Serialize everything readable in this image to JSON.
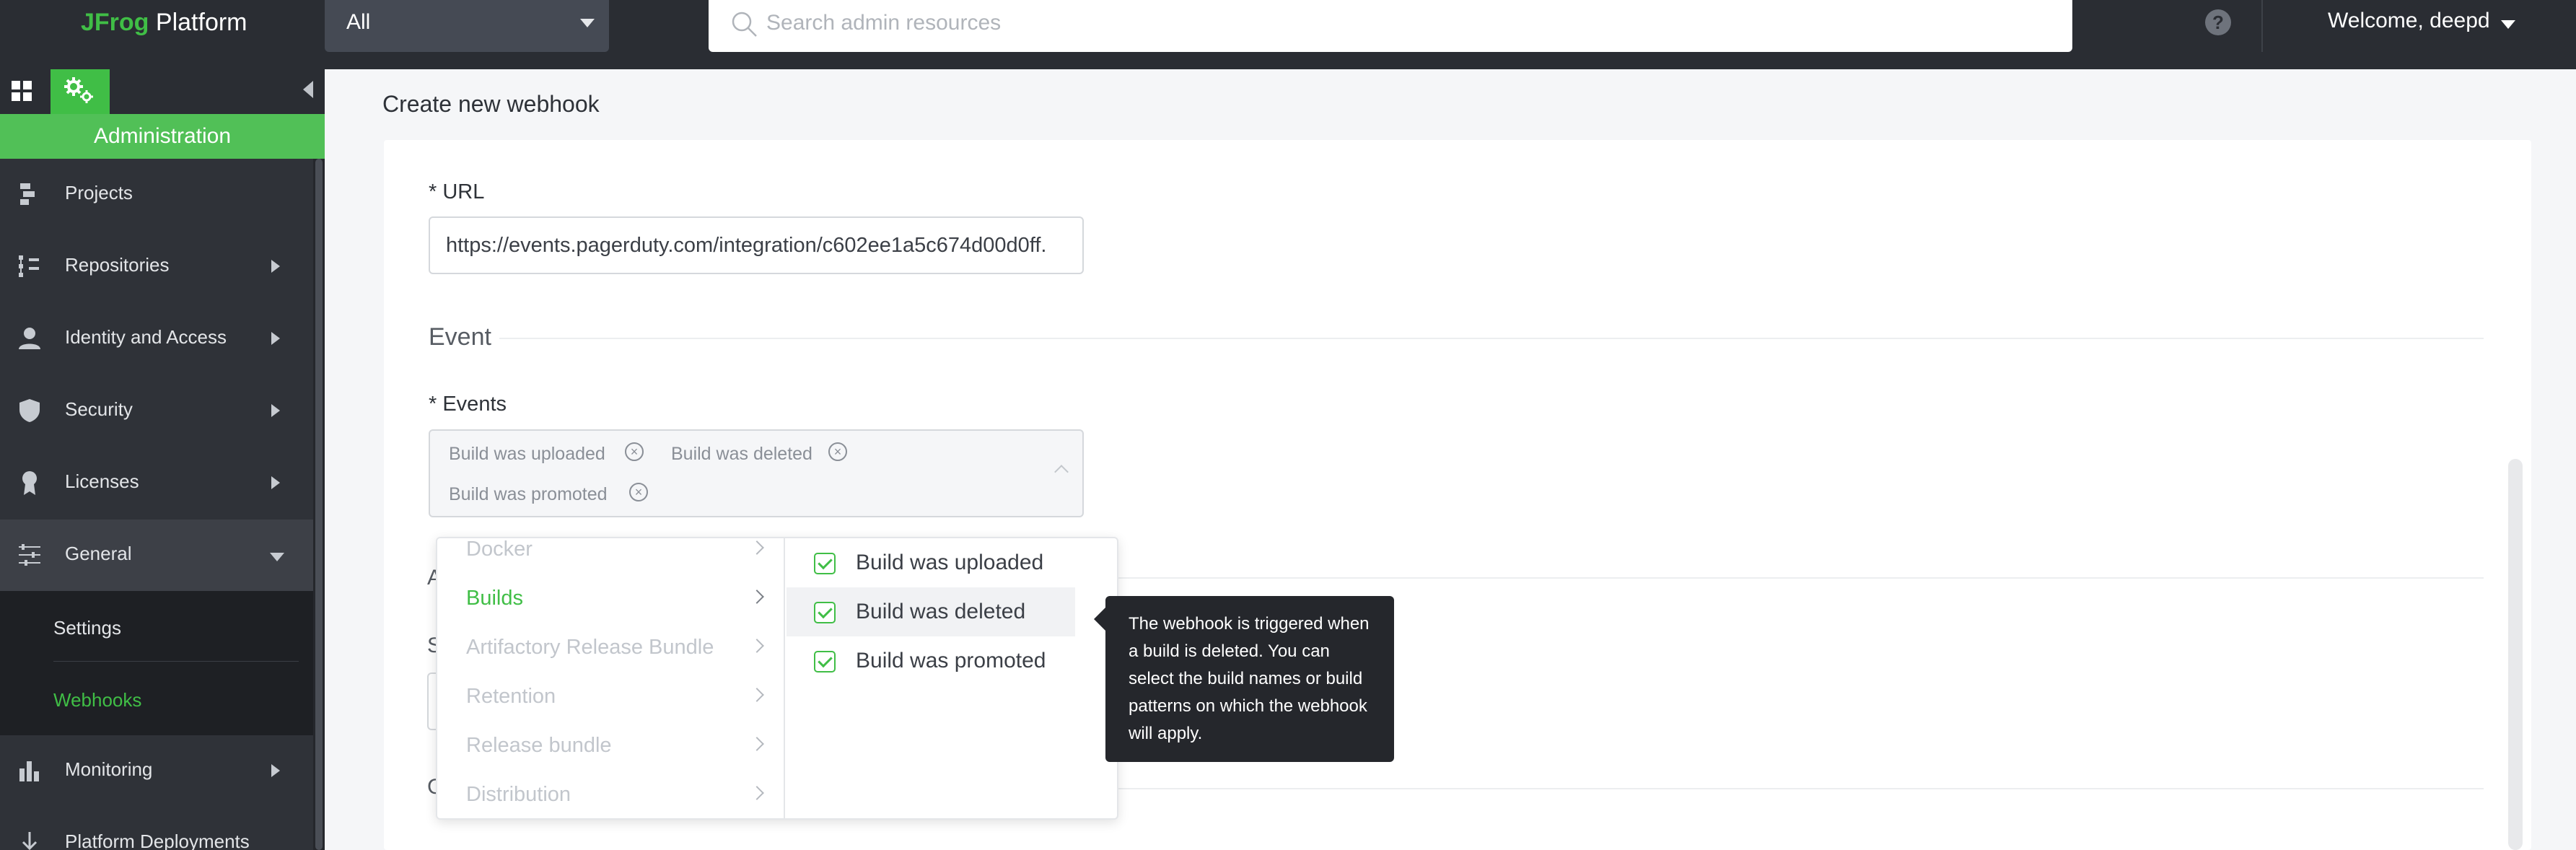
{
  "header": {
    "logo_brand": "JFrog",
    "logo_product": "Platform",
    "scope_value": "All",
    "search_placeholder": "Search admin resources",
    "help_glyph": "?",
    "welcome": "Welcome, deepd"
  },
  "sidebar": {
    "section": "Administration",
    "items": [
      {
        "label": "Projects",
        "icon": "projects-icon"
      },
      {
        "label": "Repositories",
        "icon": "repositories-icon"
      },
      {
        "label": "Identity and Access",
        "icon": "user-icon"
      },
      {
        "label": "Security",
        "icon": "shield-icon"
      },
      {
        "label": "Licenses",
        "icon": "ribbon-icon"
      },
      {
        "label": "General",
        "icon": "sliders-icon"
      },
      {
        "label": "Monitoring",
        "icon": "bar-chart-icon"
      },
      {
        "label": "Platform Deployments",
        "icon": "download-icon"
      }
    ],
    "sub_items": [
      "Settings",
      "Webhooks"
    ]
  },
  "page": {
    "title": "Create new webhook",
    "url_label": "* URL",
    "url_value": "https://events.pagerduty.com/integration/c602ee1a5c674d00d0ff.",
    "event_section": "Event",
    "events_label": "* Events",
    "selected_events": [
      "Build was uploaded",
      "Build was deleted",
      "Build was promoted"
    ],
    "partial_letters": [
      "A",
      "S",
      "C"
    ]
  },
  "dropdown": {
    "categories": [
      "Docker",
      "Builds",
      "Artifactory Release Bundle",
      "Retention",
      "Release bundle",
      "Distribution"
    ],
    "active_category": "Builds",
    "options": [
      "Build was uploaded",
      "Build was deleted",
      "Build was promoted"
    ]
  },
  "tooltip": {
    "text": "The webhook is triggered when a build is deleted. You can select the build names or build patterns on which the webhook will apply."
  },
  "colors": {
    "accent": "#40be46",
    "topbar": "#2a2d33",
    "sidebar": "#2f3238",
    "tooltip": "#25272c"
  }
}
